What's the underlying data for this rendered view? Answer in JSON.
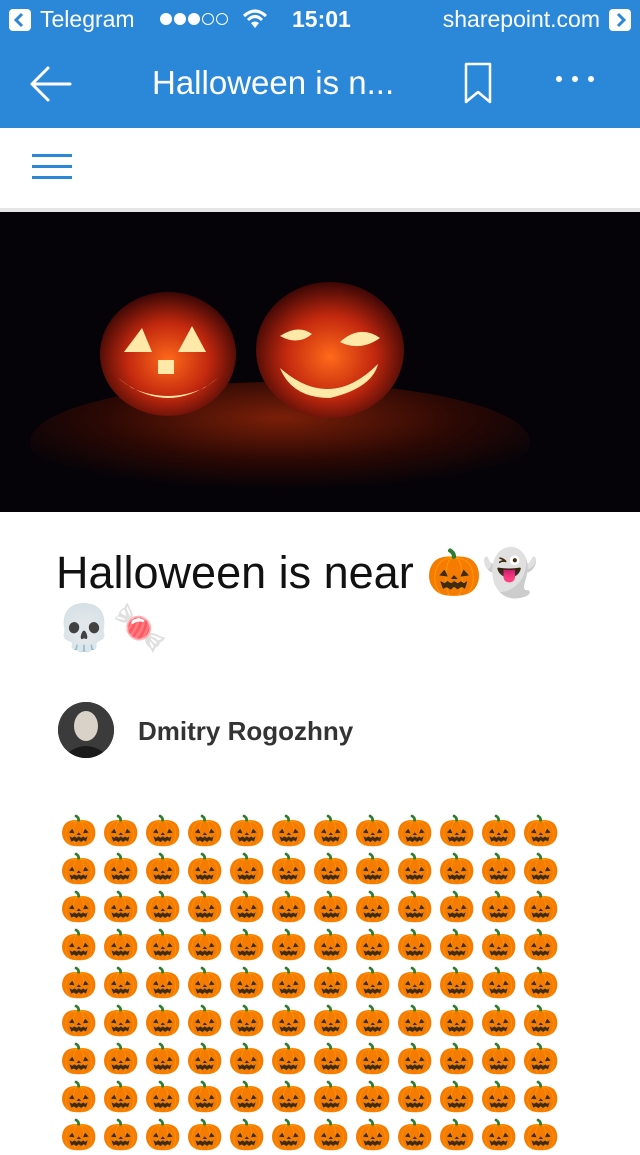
{
  "status_bar": {
    "app": "Telegram",
    "time": "15:01",
    "url": "sharepoint.com",
    "signal_bars_full": 3,
    "signal_bars_total": 5
  },
  "toolbar": {
    "title": "Halloween is n...",
    "icons": [
      "back-arrow-icon",
      "bookmark-icon",
      "more-icon"
    ]
  },
  "nav": {
    "icon": "hamburger-menu-icon",
    "accent": "#2b88d8"
  },
  "article": {
    "title": "Halloween is near 🎃👻💀🍬",
    "author": "Dmitry Rogozhny",
    "emoji": "🎃",
    "emoji_rows": 9,
    "emoji_cols": 12
  },
  "colors": {
    "brand": "#2b88d8",
    "hero_bg": "#050308"
  }
}
